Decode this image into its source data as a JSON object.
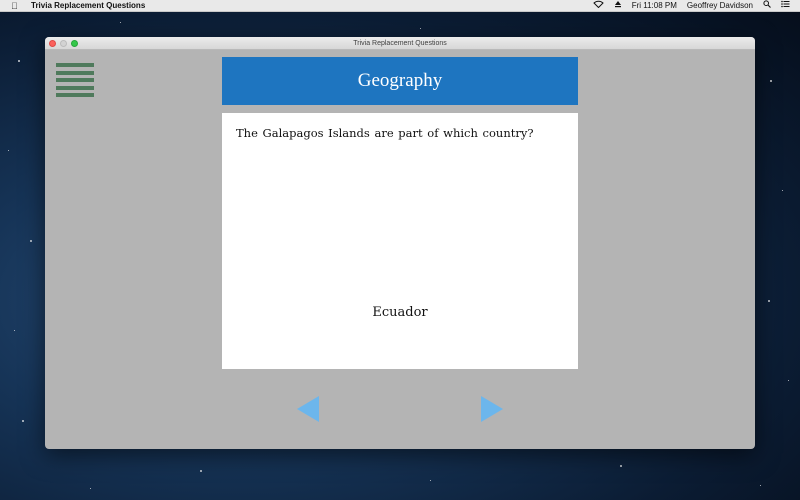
{
  "menubar": {
    "app_name": "Trivia Replacement Questions",
    "clock": "Fri 11:08 PM",
    "user": "Geoffrey Davidson"
  },
  "window": {
    "title": "Trivia Replacement Questions"
  },
  "card": {
    "category": "Geography",
    "question": "The Galapagos Islands are part of which country?",
    "answer": "Ecuador"
  },
  "colors": {
    "category_bar": "#1e75c0",
    "arrows": "#6cb6ec",
    "menu_icon": "#4f7a5c",
    "window_bg": "#b4b4b4"
  },
  "icons": {
    "prev": "left-triangle-arrow",
    "next": "right-triangle-arrow",
    "menu": "hamburger-menu"
  }
}
